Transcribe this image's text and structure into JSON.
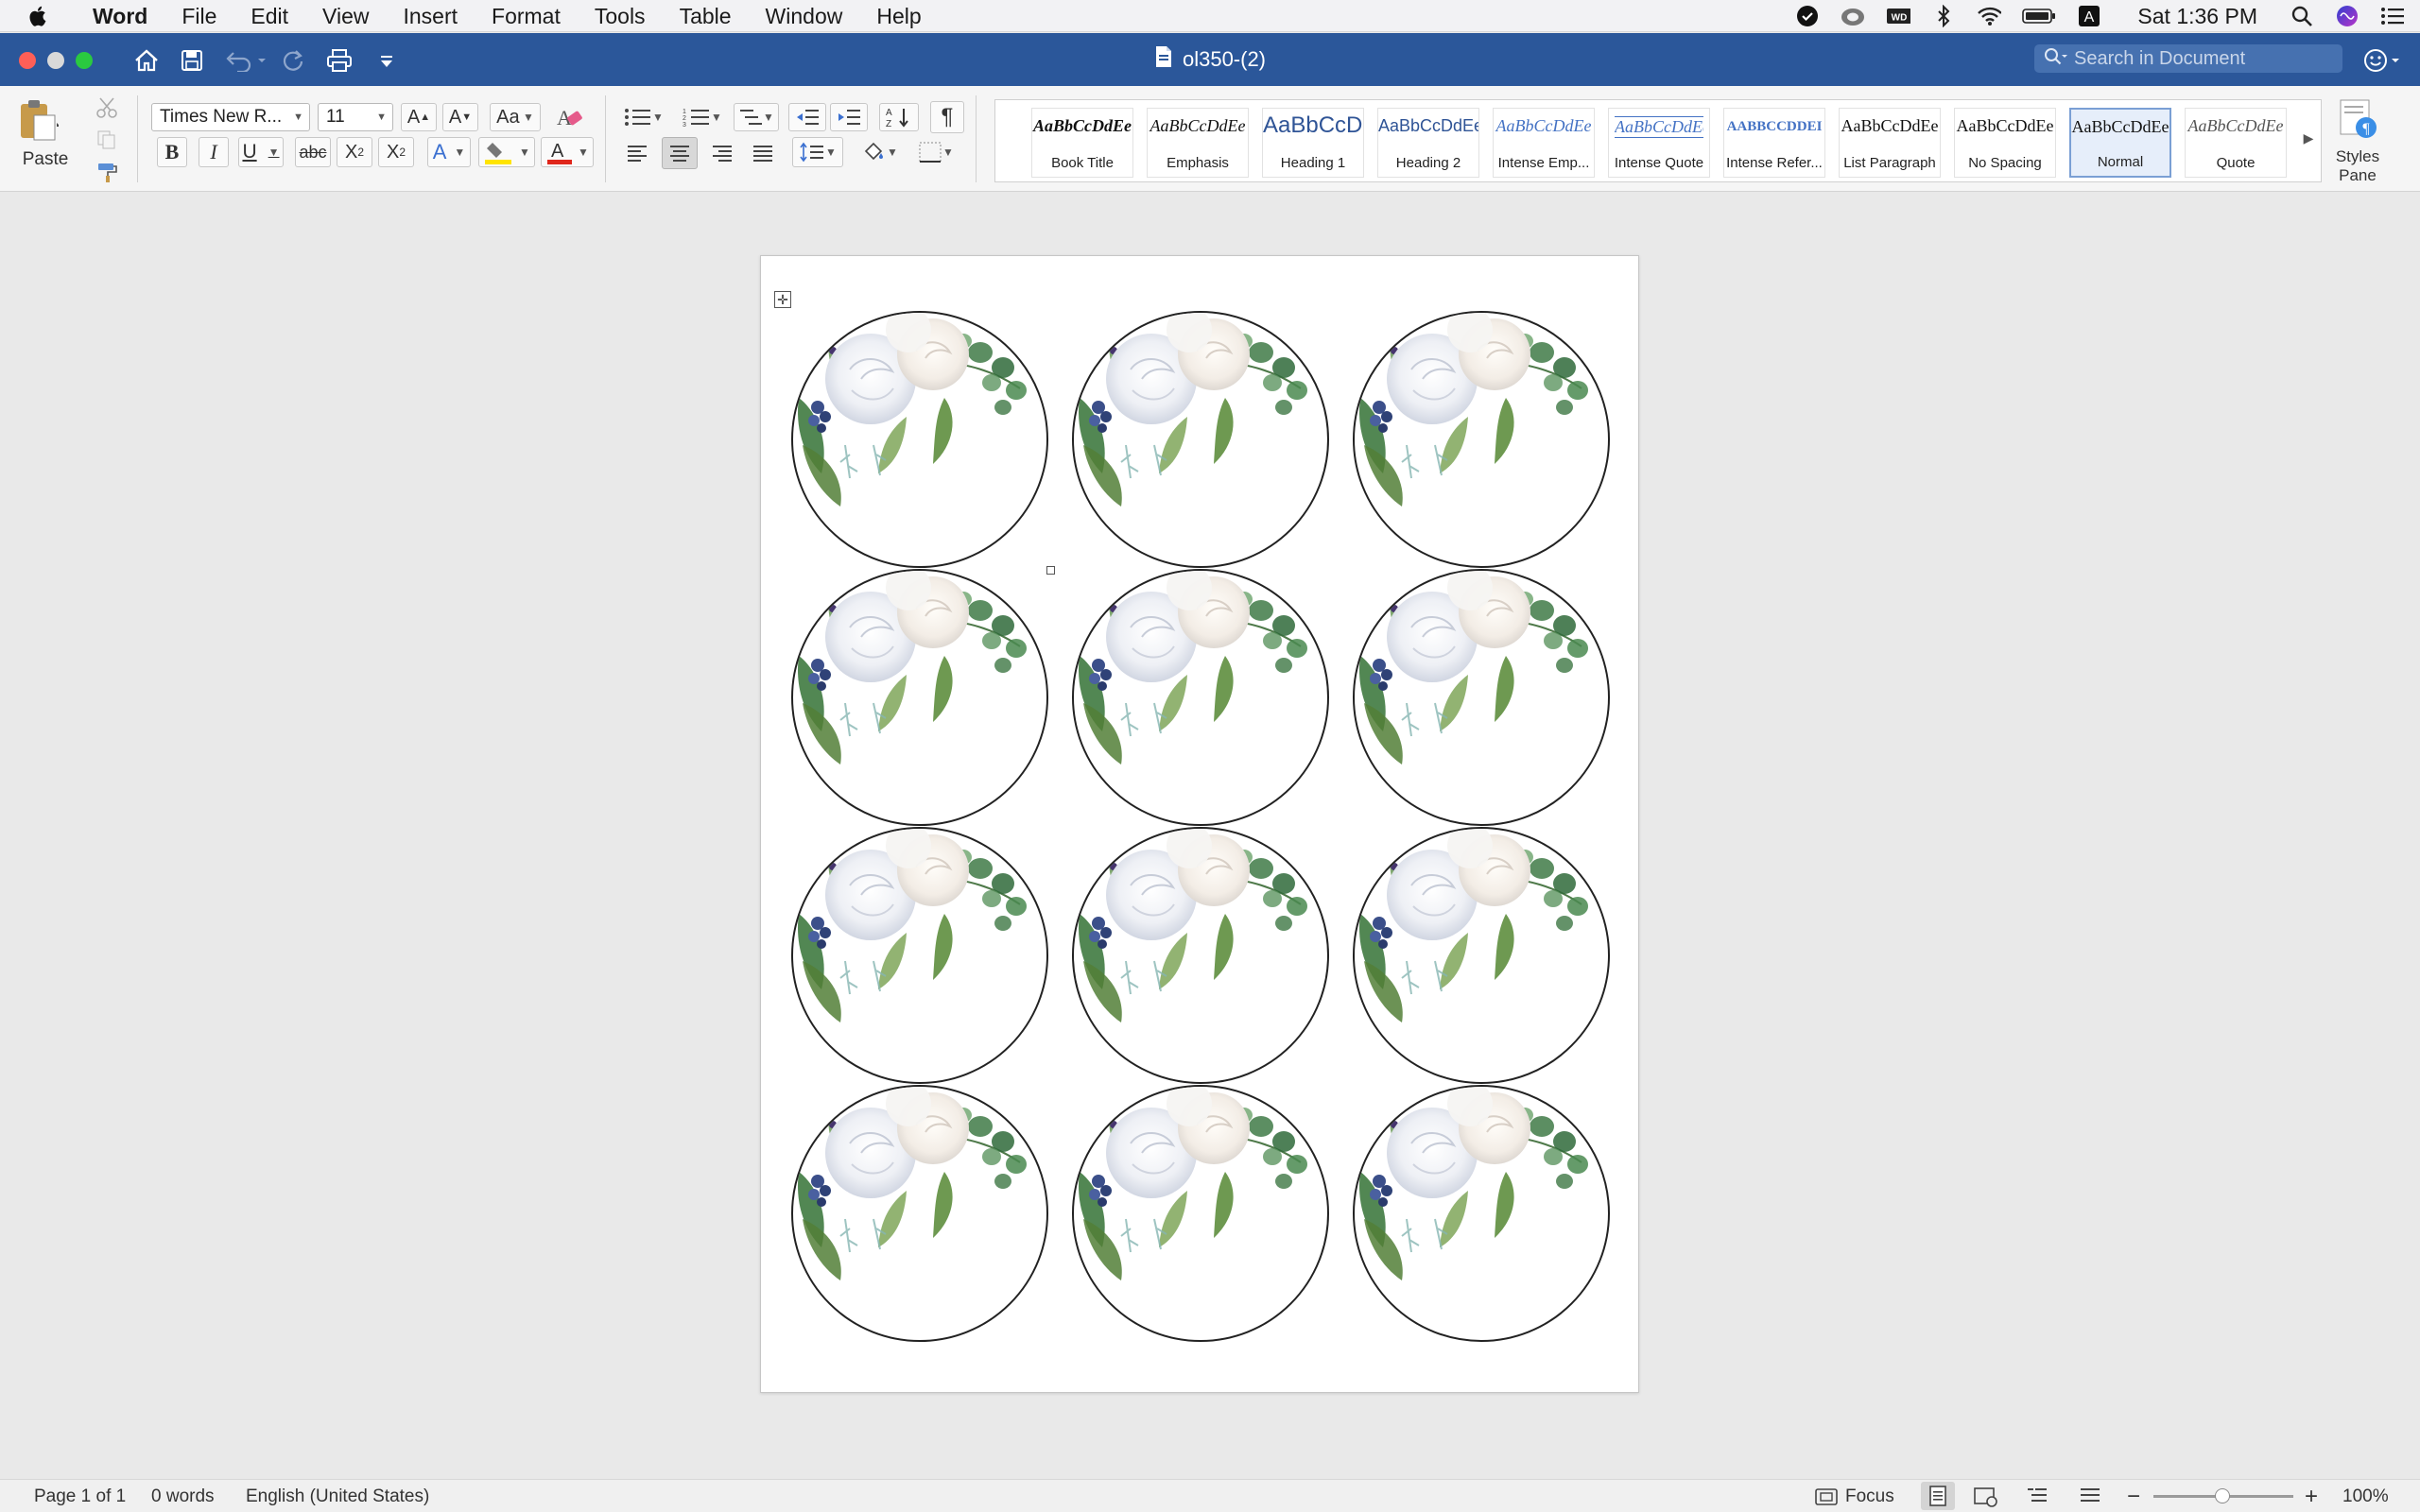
{
  "menubar": {
    "app": "Word",
    "items": [
      "File",
      "Edit",
      "View",
      "Insert",
      "Format",
      "Tools",
      "Table",
      "Window",
      "Help"
    ],
    "clock": "Sat 1:36 PM",
    "input_source": "A"
  },
  "titlebar": {
    "doc_title": "ol350-(2)",
    "search_placeholder": "Search in Document"
  },
  "ribbon": {
    "paste_label": "Paste",
    "font_name": "Times New R...",
    "font_size": "11",
    "styles": [
      {
        "preview": "AaBbCcDdEe",
        "label": "Book Title"
      },
      {
        "preview": "AaBbCcDdEe",
        "label": "Emphasis"
      },
      {
        "preview": "AaBbCcDc",
        "label": "Heading 1"
      },
      {
        "preview": "AaBbCcDdEe",
        "label": "Heading 2"
      },
      {
        "preview": "AaBbCcDdEe",
        "label": "Intense Emp..."
      },
      {
        "preview": "AaBbCcDdEe",
        "label": "Intense Quote"
      },
      {
        "preview": "AABBCCDDEI",
        "label": "Intense Refer..."
      },
      {
        "preview": "AaBbCcDdEe",
        "label": "List Paragraph"
      },
      {
        "preview": "AaBbCcDdEe",
        "label": "No Spacing"
      },
      {
        "preview": "AaBbCcDdEe",
        "label": "Normal"
      },
      {
        "preview": "AaBbCcDdEe",
        "label": "Quote"
      }
    ],
    "selected_style": "Normal",
    "styles_pane_label": "Styles\nPane"
  },
  "colors": {
    "title_bar": "#2b579a",
    "highlight": "#ffe400",
    "font_color": "#e0261b"
  },
  "document": {
    "labels": {
      "rows": 4,
      "columns": 3,
      "image": "watercolor floral bouquet (white roses, eucalyptus, blue berries)"
    }
  },
  "statusbar": {
    "page": "Page 1 of 1",
    "words": "0 words",
    "language": "English (United States)",
    "focus": "Focus",
    "zoom": "100%",
    "zoom_minus": "−",
    "zoom_plus": "+"
  }
}
